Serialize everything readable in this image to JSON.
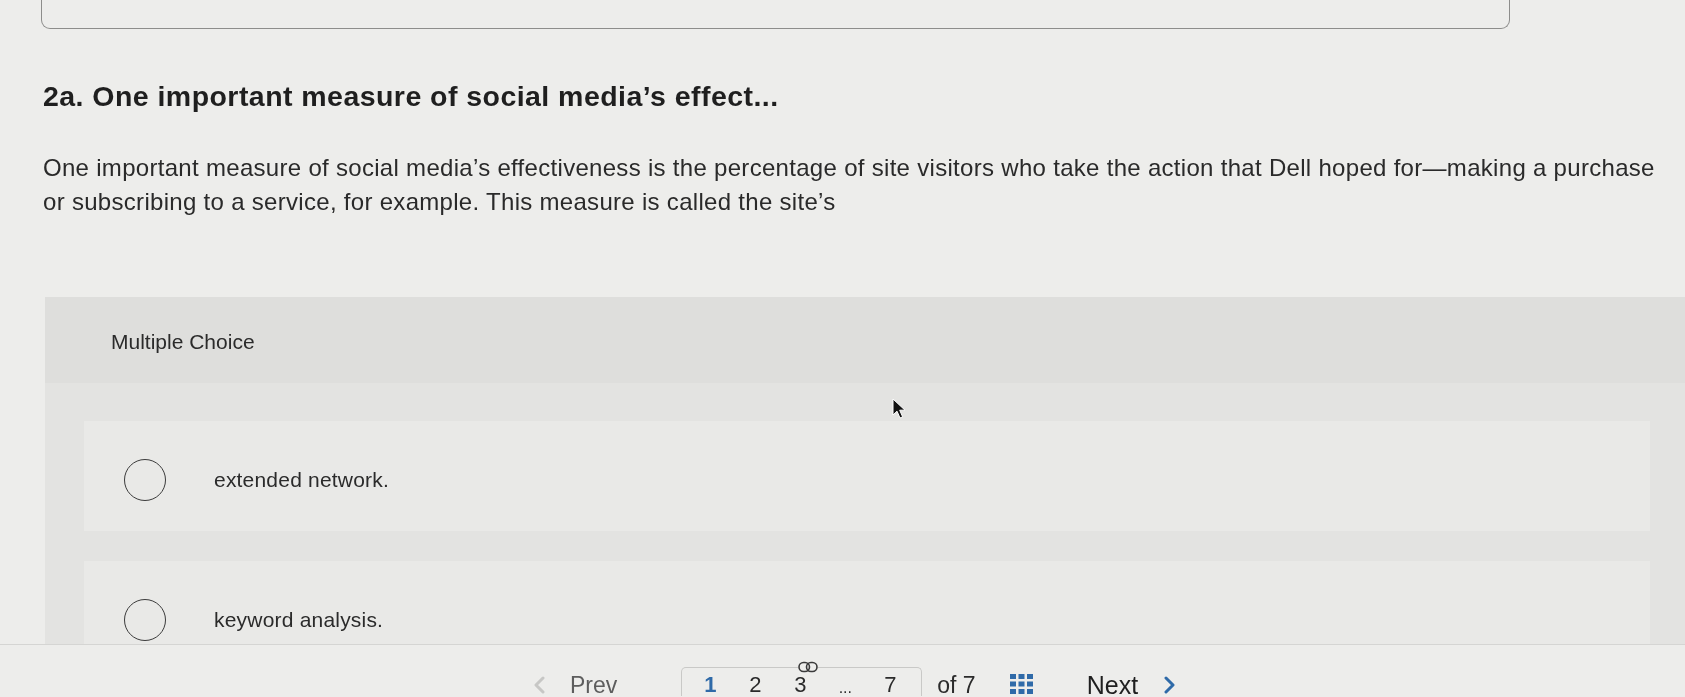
{
  "question": {
    "title": "2a. One important measure of social media’s effect...",
    "prompt": "One important measure of social media’s effectiveness is the percentage of site visitors who take the action that Dell hoped for—making a purchase or subscribing to a service, for example. This measure is called the site’s"
  },
  "multiple_choice": {
    "label": "Multiple Choice",
    "options": [
      {
        "text": "extended network.",
        "selected": false
      },
      {
        "text": "keyword analysis.",
        "selected": false
      }
    ]
  },
  "pagination": {
    "prev": {
      "label": "Prev",
      "disabled": true
    },
    "pages": [
      {
        "kind": "page",
        "label": "1",
        "selected": true,
        "linked": false
      },
      {
        "kind": "page",
        "label": "2",
        "selected": false,
        "linked": false
      },
      {
        "kind": "page",
        "label": "3",
        "selected": false,
        "linked": true
      },
      {
        "kind": "ellipsis",
        "label": "..."
      },
      {
        "kind": "page",
        "label": "7",
        "selected": false,
        "linked": false
      }
    ],
    "total": "of 7",
    "next": {
      "label": "Next",
      "disabled": false
    }
  }
}
